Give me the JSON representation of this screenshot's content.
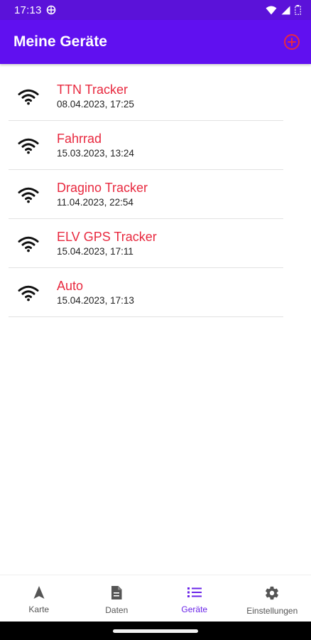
{
  "status_bar": {
    "time": "17:13",
    "icons": [
      "sync-icon",
      "wifi-icon",
      "signal-icon",
      "battery-icon"
    ]
  },
  "app_bar": {
    "title": "Meine Geräte",
    "add_icon": "add-circle-icon"
  },
  "devices": [
    {
      "name": "TTN Tracker",
      "date": "08.04.2023, 17:25",
      "icon": "wifi-icon"
    },
    {
      "name": "Fahrrad",
      "date": "15.03.2023, 13:24",
      "icon": "wifi-icon"
    },
    {
      "name": "Dragino Tracker",
      "date": "11.04.2023, 22:54",
      "icon": "wifi-icon"
    },
    {
      "name": "ELV GPS Tracker",
      "date": "15.04.2023, 17:11",
      "icon": "wifi-icon"
    },
    {
      "name": "Auto",
      "date": "15.04.2023, 17:13",
      "icon": "wifi-icon"
    }
  ],
  "bottom_nav": {
    "items": [
      {
        "label": "Karte",
        "icon": "navigation-arrow-icon",
        "active": false
      },
      {
        "label": "Daten",
        "icon": "document-icon",
        "active": false
      },
      {
        "label": "Geräte",
        "icon": "list-icon",
        "active": true
      },
      {
        "label": "Einstellungen",
        "icon": "gear-icon",
        "active": false
      }
    ]
  },
  "colors": {
    "status_bar": "#5B12D9",
    "app_bar": "#6010F0",
    "accent_red": "#E8293F",
    "active_nav": "#6A24E8"
  }
}
